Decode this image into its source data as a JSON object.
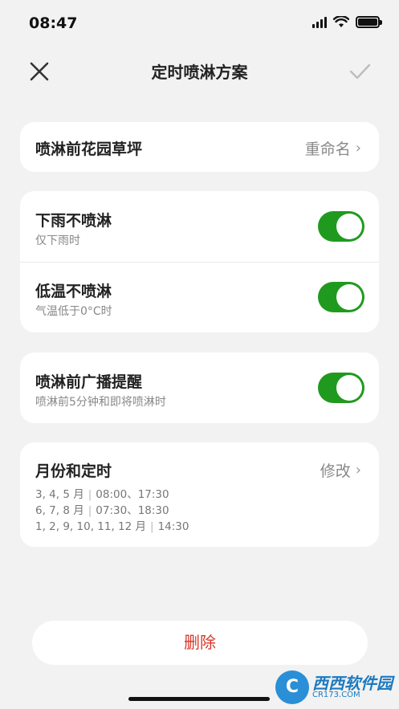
{
  "status_bar": {
    "time": "08:47"
  },
  "nav": {
    "title": "定时喷淋方案"
  },
  "plan": {
    "name": "喷淋前花园草坪",
    "rename_label": "重命名"
  },
  "rules": [
    {
      "title": "下雨不喷淋",
      "subtitle": "仅下雨时",
      "enabled": true
    },
    {
      "title": "低温不喷淋",
      "subtitle": "气温低于0°C时",
      "enabled": true
    }
  ],
  "reminder": {
    "title": "喷淋前广播提醒",
    "subtitle": "喷淋前5分钟和即将喷淋时",
    "enabled": true
  },
  "schedule": {
    "title": "月份和定时",
    "edit_label": "修改",
    "entries": [
      {
        "months": "3, 4, 5 月",
        "times": "08:00、17:30"
      },
      {
        "months": "6, 7, 8 月",
        "times": "07:30、18:30"
      },
      {
        "months": "1, 2, 9, 10, 11, 12 月",
        "times": "14:30"
      }
    ]
  },
  "delete_label": "删除",
  "watermark": {
    "logo": "C",
    "text": "西西软件园",
    "sub": "CR173.COM"
  },
  "colors": {
    "accent": "#1f9a1f",
    "danger": "#d8362a",
    "background": "#f2f2f2"
  }
}
